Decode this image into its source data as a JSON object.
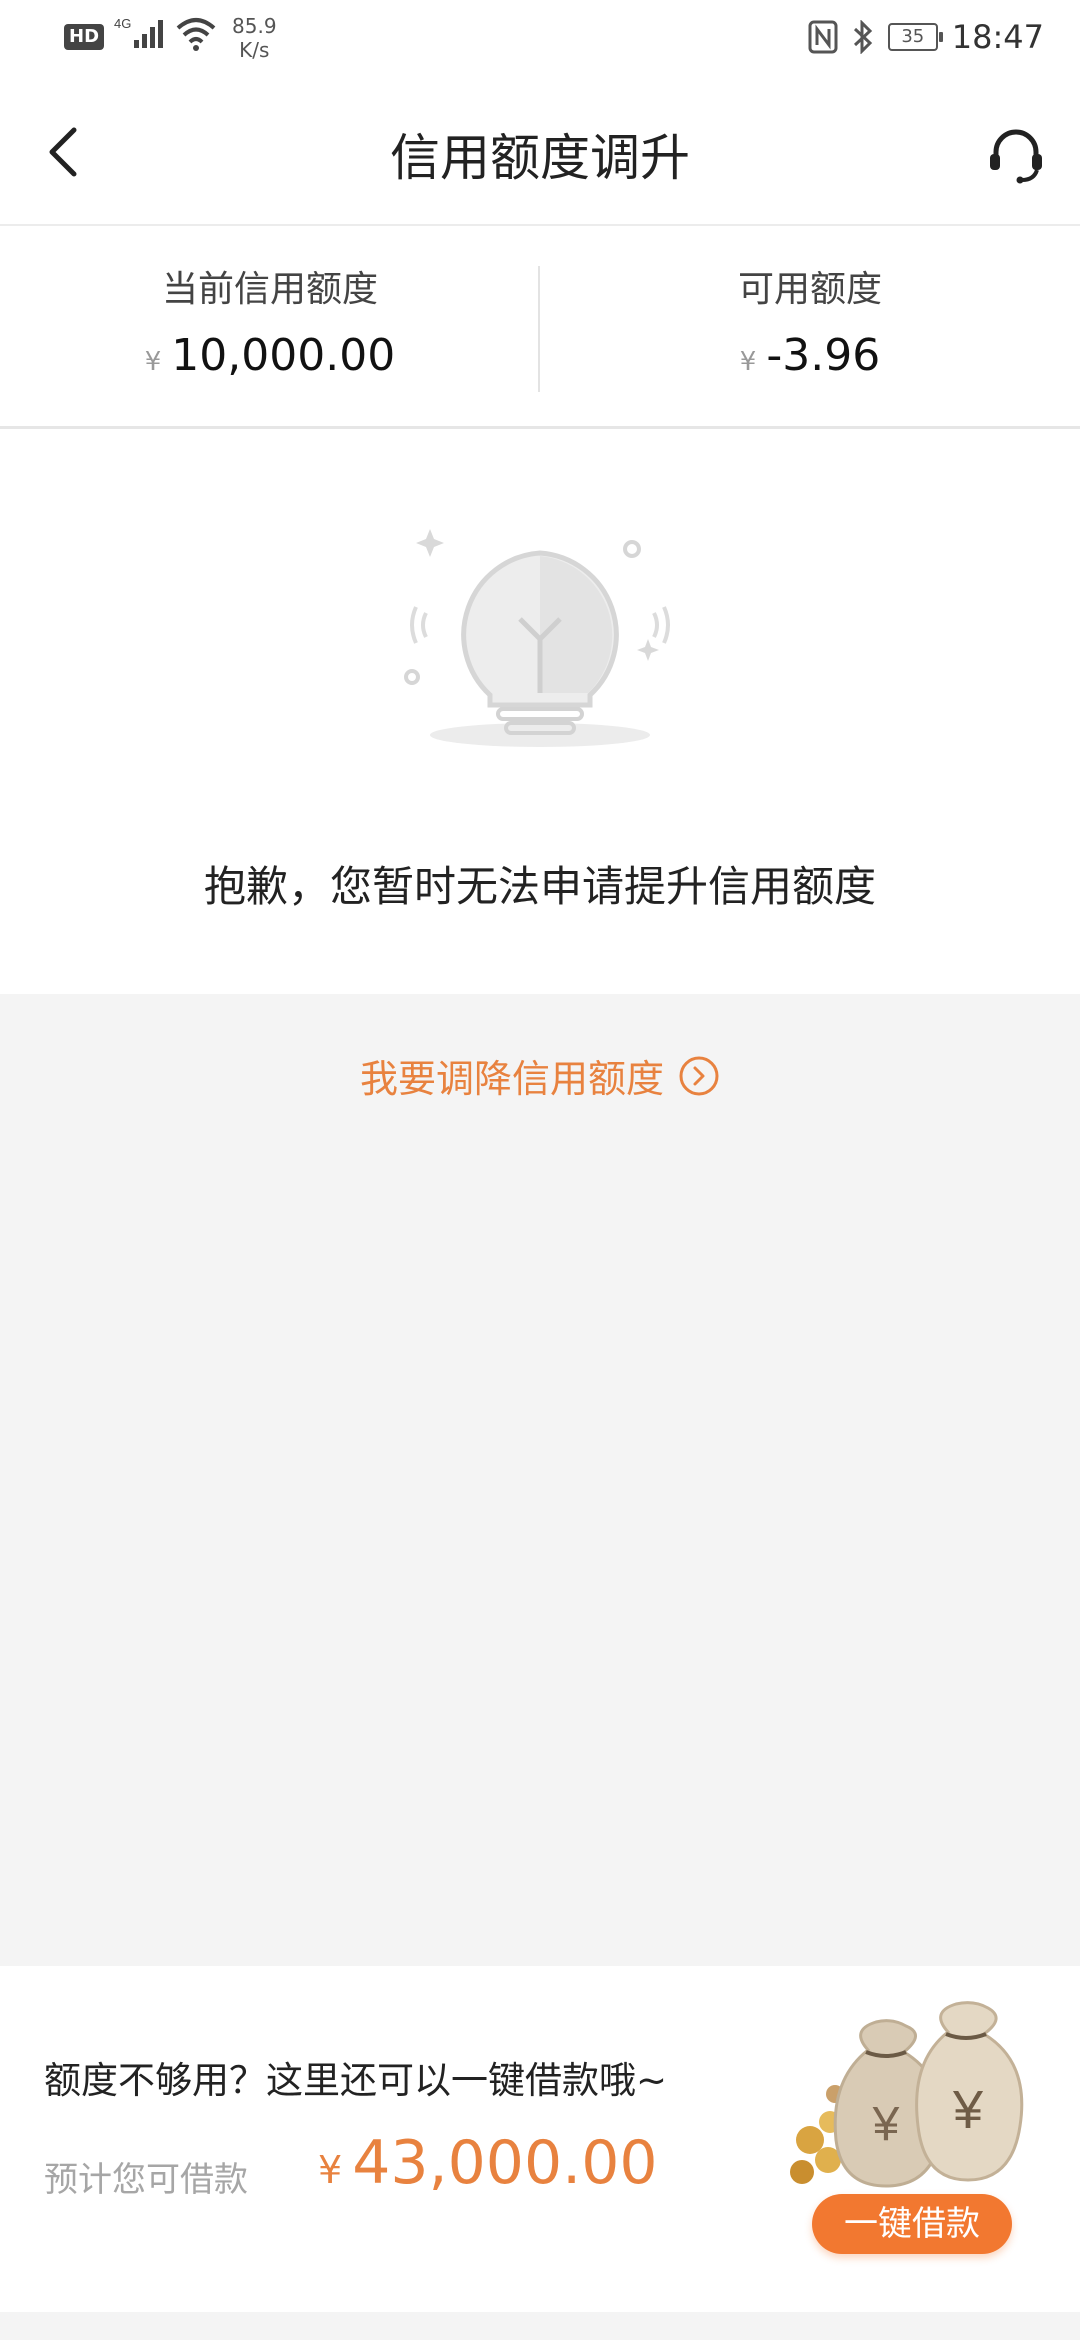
{
  "status_bar": {
    "hd": "HD",
    "network_type": "4G",
    "speed_value": "85.9",
    "speed_unit": "K/s",
    "battery": "35",
    "time": "18:47"
  },
  "header": {
    "title": "信用额度调升",
    "back_icon": "chevron-left-icon",
    "service_icon": "headset-icon"
  },
  "credit": {
    "current_label": "当前信用额度",
    "current_currency": "¥",
    "current_value": "10,000.00",
    "available_label": "可用额度",
    "available_currency": "¥",
    "available_value": "-3.96"
  },
  "empty_state": {
    "icon": "lightbulb-icon",
    "message": "抱歉，您暂时无法申请提升信用额度"
  },
  "reduce_link": {
    "label": "我要调降信用额度",
    "icon": "circle-arrow-right-icon"
  },
  "loan_card": {
    "prompt": "额度不够用？这里还可以一键借款哦~",
    "estimate_label": "预计您可借款",
    "currency": "¥",
    "amount": "43,000.00",
    "button_label": "一键借款",
    "illustration_icon": "money-bags-icon"
  },
  "colors": {
    "accent": "#e8823f",
    "button": "#f27830",
    "background": "#f4f4f4"
  }
}
